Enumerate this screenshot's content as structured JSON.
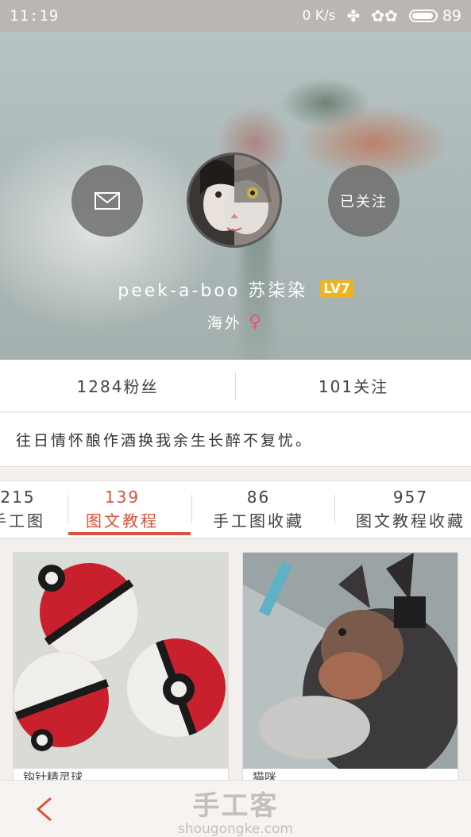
{
  "status_bar": {
    "time": "11:19",
    "speed": "0 K/s",
    "battery": "89",
    "icons": [
      "clover-icon",
      "signal-icon",
      "battery-icon"
    ]
  },
  "profile": {
    "follow_label": "已关注",
    "username": "peek-a-boo 苏柒染",
    "level": "LV7",
    "location": "海外",
    "gender_symbol": "♀",
    "accent_color": "#d9533c",
    "level_color": "#f1b31c"
  },
  "stats": {
    "fans": "1284粉丝",
    "following": "101关注"
  },
  "bio": "往日情怀酿作酒换我余生长醉不复忧。",
  "tabs": [
    {
      "count": "215",
      "label": "手工图"
    },
    {
      "count": "139",
      "label": "图文教程",
      "active": true
    },
    {
      "count": "86",
      "label": "手工图收藏"
    },
    {
      "count": "957",
      "label": "图文教程收藏"
    }
  ],
  "cards": [
    {
      "title": "钩针精灵球",
      "image": "crochet-pokeball-image"
    },
    {
      "title": "猫咪",
      "image": "cat-photo-image"
    }
  ],
  "watermark": {
    "cn": "手工客",
    "url": "shougongke.com"
  }
}
